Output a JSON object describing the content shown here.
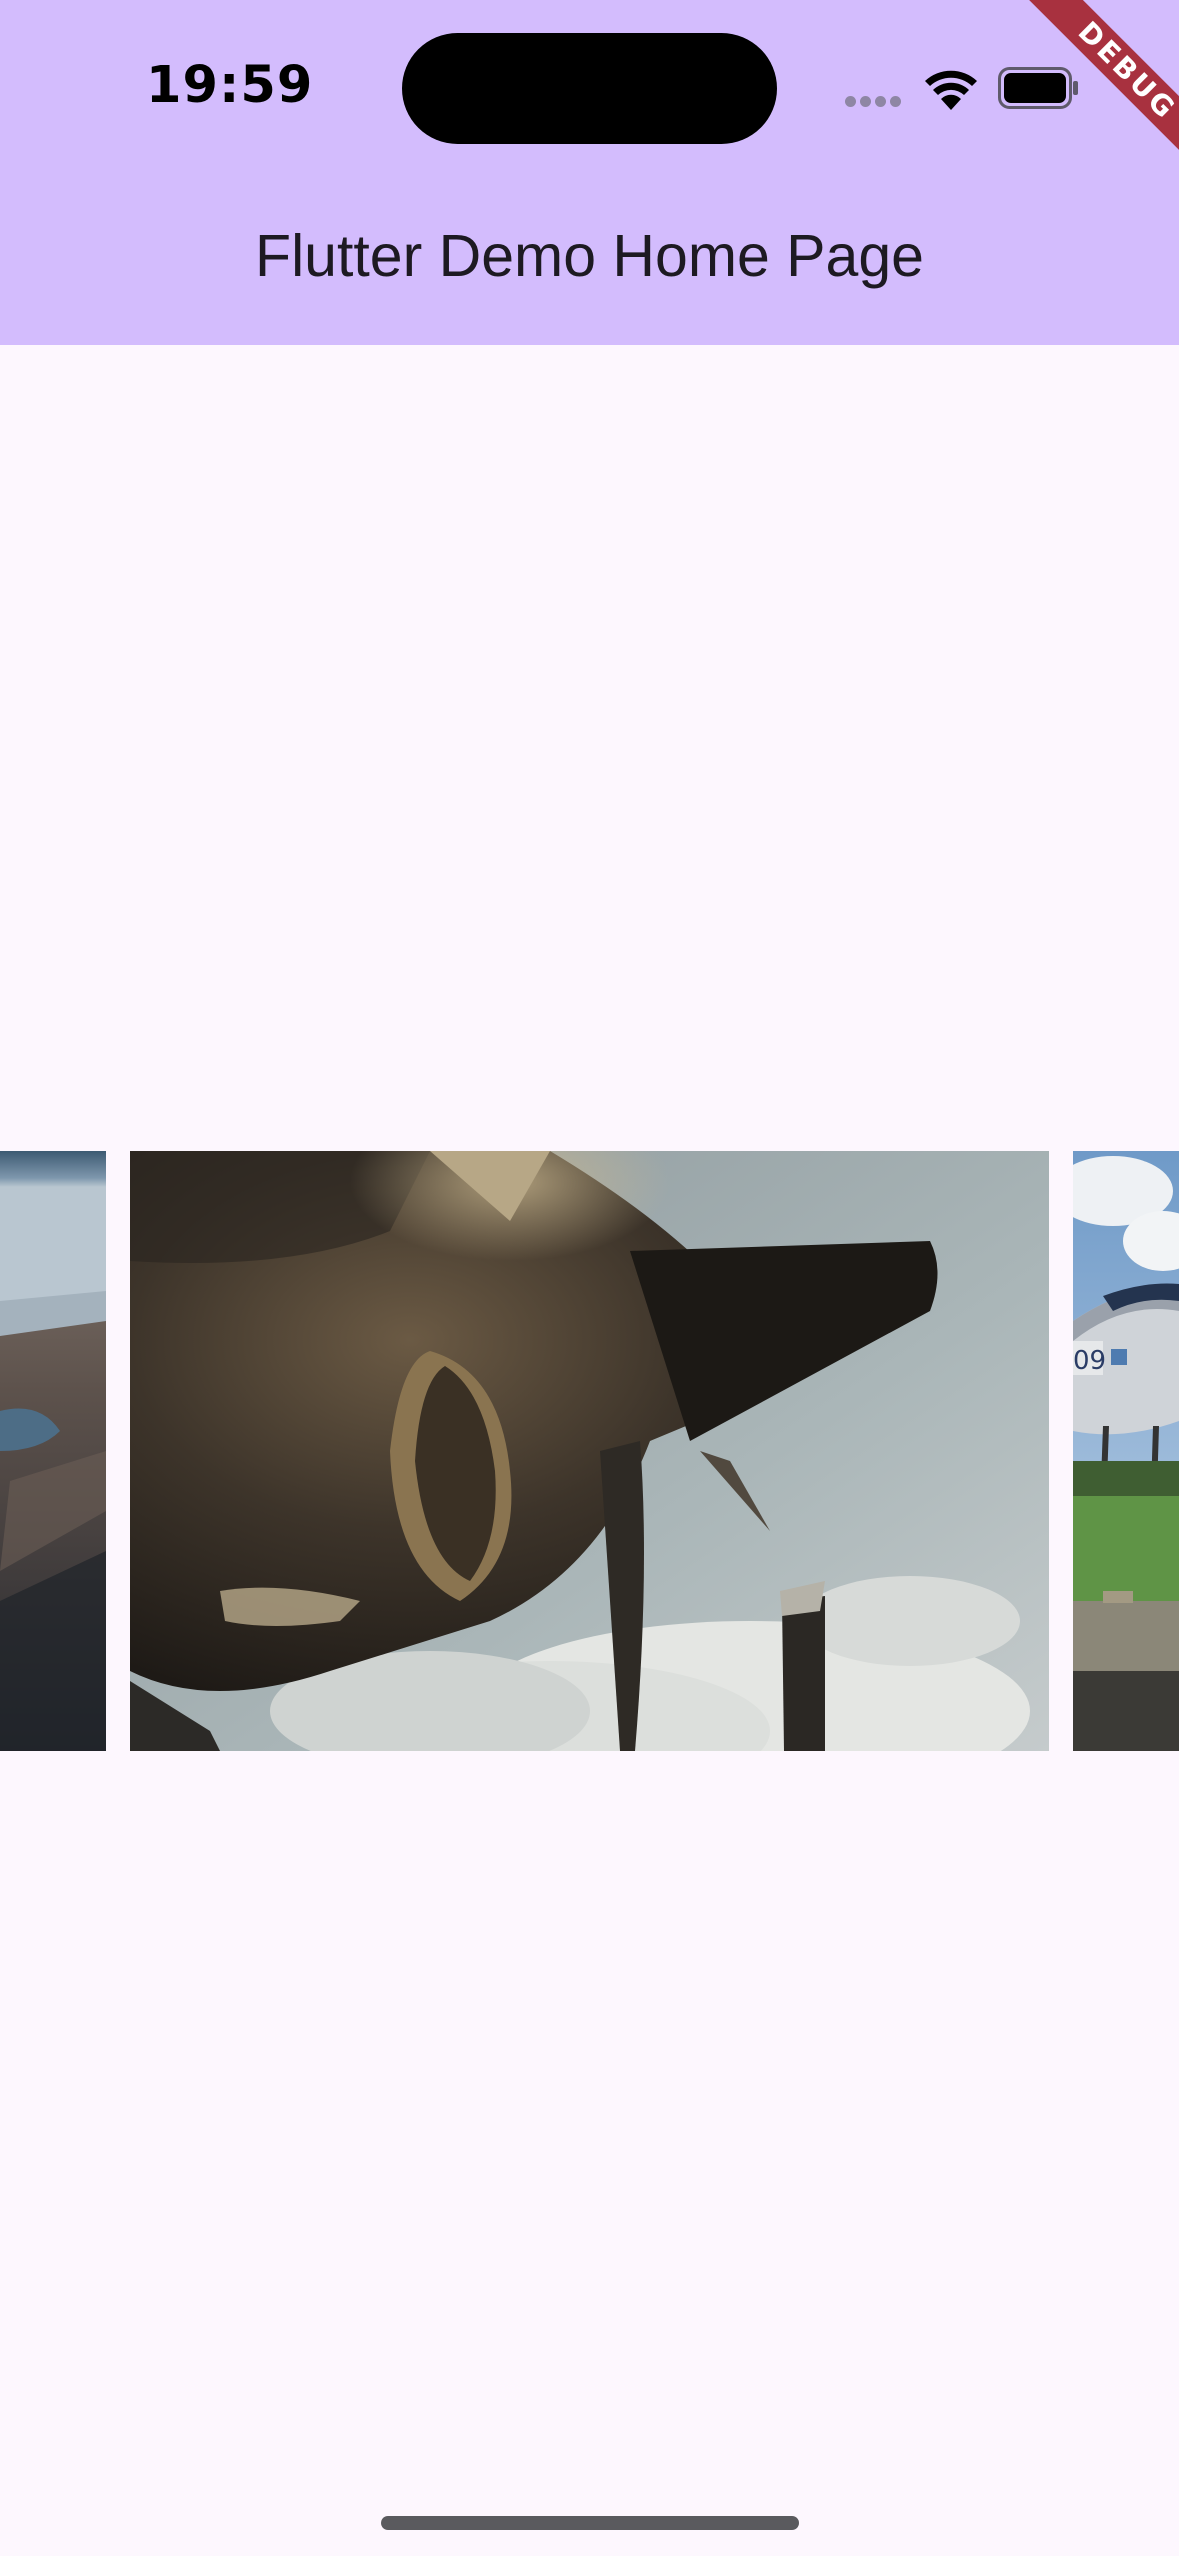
{
  "status_bar": {
    "time": "19:59",
    "icons": [
      "cellular-dots-icon",
      "wifi-icon",
      "battery-icon"
    ]
  },
  "debug_banner": {
    "label": "DEBUG",
    "color": "#a8313f"
  },
  "app_bar": {
    "title": "Flutter Demo Home Page",
    "background": "#d3bcfd"
  },
  "carousel": {
    "items": [
      {
        "name": "coastline-aerial-photo"
      },
      {
        "name": "propeller-engine-photo"
      },
      {
        "name": "parked-airplane-photo"
      }
    ]
  },
  "colors": {
    "page_background": "#fdf7fe",
    "title_text": "#1d1a22"
  }
}
